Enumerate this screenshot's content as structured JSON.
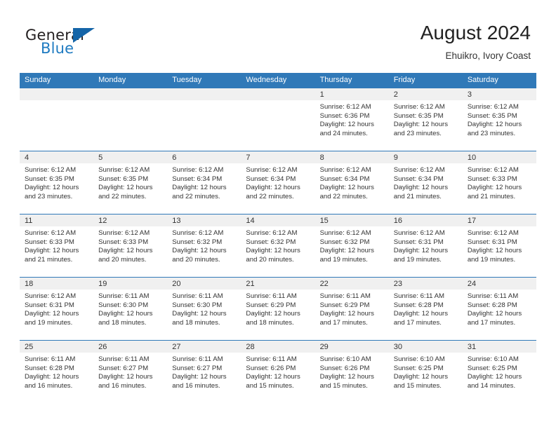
{
  "brand": {
    "name_top": "General",
    "name_bottom": "Blue",
    "flag_icon": "triangle-flag-icon",
    "accent_color": "#1f7bc1"
  },
  "header": {
    "title": "August 2024",
    "subtitle": "Ehuikro, Ivory Coast"
  },
  "theme": {
    "header_bg": "#3079b8",
    "daynum_bg": "#f0f0f0",
    "grid_line": "#3079b8",
    "text": "#333333"
  },
  "calendar": {
    "weekday_headers": [
      "Sunday",
      "Monday",
      "Tuesday",
      "Wednesday",
      "Thursday",
      "Friday",
      "Saturday"
    ],
    "weeks": [
      [
        {
          "day": "",
          "sunrise": "",
          "sunset": "",
          "daylight_line1": "",
          "daylight_line2": ""
        },
        {
          "day": "",
          "sunrise": "",
          "sunset": "",
          "daylight_line1": "",
          "daylight_line2": ""
        },
        {
          "day": "",
          "sunrise": "",
          "sunset": "",
          "daylight_line1": "",
          "daylight_line2": ""
        },
        {
          "day": "",
          "sunrise": "",
          "sunset": "",
          "daylight_line1": "",
          "daylight_line2": ""
        },
        {
          "day": "1",
          "sunrise": "Sunrise: 6:12 AM",
          "sunset": "Sunset: 6:36 PM",
          "daylight_line1": "Daylight: 12 hours",
          "daylight_line2": "and 24 minutes."
        },
        {
          "day": "2",
          "sunrise": "Sunrise: 6:12 AM",
          "sunset": "Sunset: 6:35 PM",
          "daylight_line1": "Daylight: 12 hours",
          "daylight_line2": "and 23 minutes."
        },
        {
          "day": "3",
          "sunrise": "Sunrise: 6:12 AM",
          "sunset": "Sunset: 6:35 PM",
          "daylight_line1": "Daylight: 12 hours",
          "daylight_line2": "and 23 minutes."
        }
      ],
      [
        {
          "day": "4",
          "sunrise": "Sunrise: 6:12 AM",
          "sunset": "Sunset: 6:35 PM",
          "daylight_line1": "Daylight: 12 hours",
          "daylight_line2": "and 23 minutes."
        },
        {
          "day": "5",
          "sunrise": "Sunrise: 6:12 AM",
          "sunset": "Sunset: 6:35 PM",
          "daylight_line1": "Daylight: 12 hours",
          "daylight_line2": "and 22 minutes."
        },
        {
          "day": "6",
          "sunrise": "Sunrise: 6:12 AM",
          "sunset": "Sunset: 6:34 PM",
          "daylight_line1": "Daylight: 12 hours",
          "daylight_line2": "and 22 minutes."
        },
        {
          "day": "7",
          "sunrise": "Sunrise: 6:12 AM",
          "sunset": "Sunset: 6:34 PM",
          "daylight_line1": "Daylight: 12 hours",
          "daylight_line2": "and 22 minutes."
        },
        {
          "day": "8",
          "sunrise": "Sunrise: 6:12 AM",
          "sunset": "Sunset: 6:34 PM",
          "daylight_line1": "Daylight: 12 hours",
          "daylight_line2": "and 22 minutes."
        },
        {
          "day": "9",
          "sunrise": "Sunrise: 6:12 AM",
          "sunset": "Sunset: 6:34 PM",
          "daylight_line1": "Daylight: 12 hours",
          "daylight_line2": "and 21 minutes."
        },
        {
          "day": "10",
          "sunrise": "Sunrise: 6:12 AM",
          "sunset": "Sunset: 6:33 PM",
          "daylight_line1": "Daylight: 12 hours",
          "daylight_line2": "and 21 minutes."
        }
      ],
      [
        {
          "day": "11",
          "sunrise": "Sunrise: 6:12 AM",
          "sunset": "Sunset: 6:33 PM",
          "daylight_line1": "Daylight: 12 hours",
          "daylight_line2": "and 21 minutes."
        },
        {
          "day": "12",
          "sunrise": "Sunrise: 6:12 AM",
          "sunset": "Sunset: 6:33 PM",
          "daylight_line1": "Daylight: 12 hours",
          "daylight_line2": "and 20 minutes."
        },
        {
          "day": "13",
          "sunrise": "Sunrise: 6:12 AM",
          "sunset": "Sunset: 6:32 PM",
          "daylight_line1": "Daylight: 12 hours",
          "daylight_line2": "and 20 minutes."
        },
        {
          "day": "14",
          "sunrise": "Sunrise: 6:12 AM",
          "sunset": "Sunset: 6:32 PM",
          "daylight_line1": "Daylight: 12 hours",
          "daylight_line2": "and 20 minutes."
        },
        {
          "day": "15",
          "sunrise": "Sunrise: 6:12 AM",
          "sunset": "Sunset: 6:32 PM",
          "daylight_line1": "Daylight: 12 hours",
          "daylight_line2": "and 19 minutes."
        },
        {
          "day": "16",
          "sunrise": "Sunrise: 6:12 AM",
          "sunset": "Sunset: 6:31 PM",
          "daylight_line1": "Daylight: 12 hours",
          "daylight_line2": "and 19 minutes."
        },
        {
          "day": "17",
          "sunrise": "Sunrise: 6:12 AM",
          "sunset": "Sunset: 6:31 PM",
          "daylight_line1": "Daylight: 12 hours",
          "daylight_line2": "and 19 minutes."
        }
      ],
      [
        {
          "day": "18",
          "sunrise": "Sunrise: 6:12 AM",
          "sunset": "Sunset: 6:31 PM",
          "daylight_line1": "Daylight: 12 hours",
          "daylight_line2": "and 19 minutes."
        },
        {
          "day": "19",
          "sunrise": "Sunrise: 6:11 AM",
          "sunset": "Sunset: 6:30 PM",
          "daylight_line1": "Daylight: 12 hours",
          "daylight_line2": "and 18 minutes."
        },
        {
          "day": "20",
          "sunrise": "Sunrise: 6:11 AM",
          "sunset": "Sunset: 6:30 PM",
          "daylight_line1": "Daylight: 12 hours",
          "daylight_line2": "and 18 minutes."
        },
        {
          "day": "21",
          "sunrise": "Sunrise: 6:11 AM",
          "sunset": "Sunset: 6:29 PM",
          "daylight_line1": "Daylight: 12 hours",
          "daylight_line2": "and 18 minutes."
        },
        {
          "day": "22",
          "sunrise": "Sunrise: 6:11 AM",
          "sunset": "Sunset: 6:29 PM",
          "daylight_line1": "Daylight: 12 hours",
          "daylight_line2": "and 17 minutes."
        },
        {
          "day": "23",
          "sunrise": "Sunrise: 6:11 AM",
          "sunset": "Sunset: 6:28 PM",
          "daylight_line1": "Daylight: 12 hours",
          "daylight_line2": "and 17 minutes."
        },
        {
          "day": "24",
          "sunrise": "Sunrise: 6:11 AM",
          "sunset": "Sunset: 6:28 PM",
          "daylight_line1": "Daylight: 12 hours",
          "daylight_line2": "and 17 minutes."
        }
      ],
      [
        {
          "day": "25",
          "sunrise": "Sunrise: 6:11 AM",
          "sunset": "Sunset: 6:28 PM",
          "daylight_line1": "Daylight: 12 hours",
          "daylight_line2": "and 16 minutes."
        },
        {
          "day": "26",
          "sunrise": "Sunrise: 6:11 AM",
          "sunset": "Sunset: 6:27 PM",
          "daylight_line1": "Daylight: 12 hours",
          "daylight_line2": "and 16 minutes."
        },
        {
          "day": "27",
          "sunrise": "Sunrise: 6:11 AM",
          "sunset": "Sunset: 6:27 PM",
          "daylight_line1": "Daylight: 12 hours",
          "daylight_line2": "and 16 minutes."
        },
        {
          "day": "28",
          "sunrise": "Sunrise: 6:11 AM",
          "sunset": "Sunset: 6:26 PM",
          "daylight_line1": "Daylight: 12 hours",
          "daylight_line2": "and 15 minutes."
        },
        {
          "day": "29",
          "sunrise": "Sunrise: 6:10 AM",
          "sunset": "Sunset: 6:26 PM",
          "daylight_line1": "Daylight: 12 hours",
          "daylight_line2": "and 15 minutes."
        },
        {
          "day": "30",
          "sunrise": "Sunrise: 6:10 AM",
          "sunset": "Sunset: 6:25 PM",
          "daylight_line1": "Daylight: 12 hours",
          "daylight_line2": "and 15 minutes."
        },
        {
          "day": "31",
          "sunrise": "Sunrise: 6:10 AM",
          "sunset": "Sunset: 6:25 PM",
          "daylight_line1": "Daylight: 12 hours",
          "daylight_line2": "and 14 minutes."
        }
      ]
    ]
  }
}
